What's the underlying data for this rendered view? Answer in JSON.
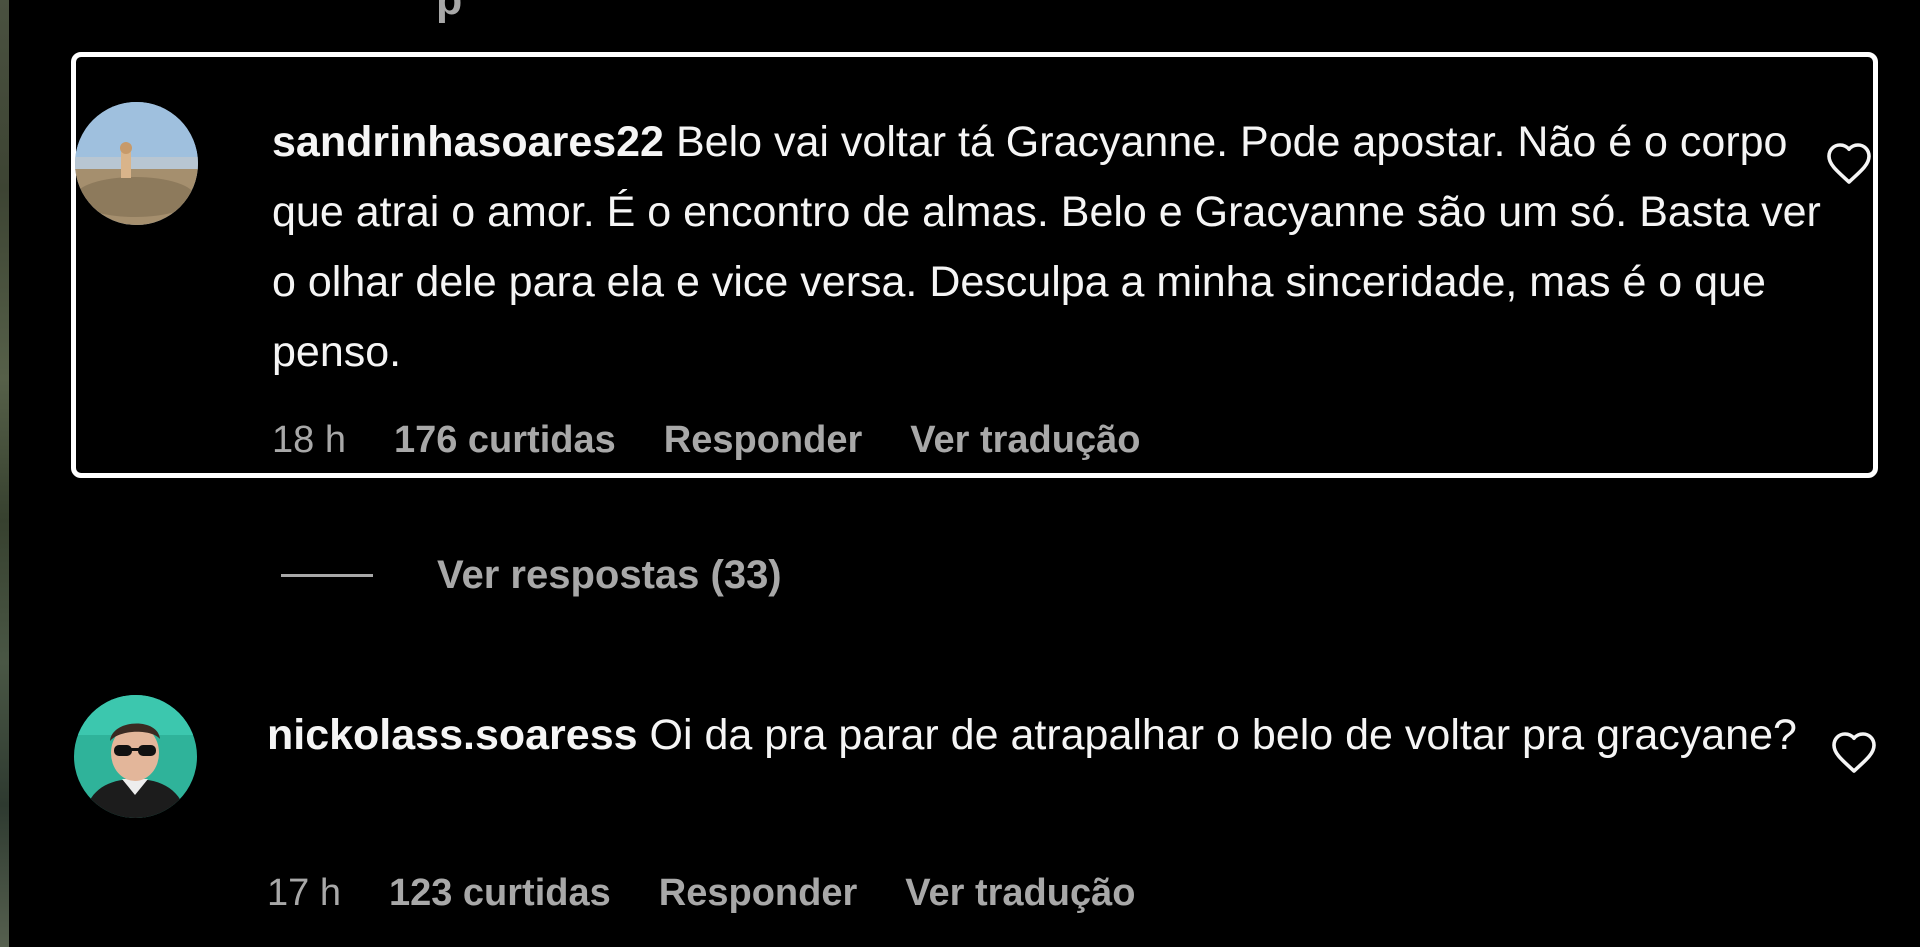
{
  "top_partial": "p",
  "comments": [
    {
      "username": "sandrinhasoares22",
      "text": "Belo vai voltar tá Gracyanne. Pode apostar. Não é o corpo que atrai o amor. É o encontro de almas. Belo e Gracyanne são um só. Basta ver o olhar dele para ela e vice versa. Desculpa a minha sinceridade, mas é o que penso.",
      "time": "18 h",
      "likes": "176 curtidas",
      "reply_label": "Responder",
      "translate_label": "Ver tradução",
      "like_icon": "heart-outline-icon"
    },
    {
      "username": "nickolass.soaress",
      "text": "Oi da pra parar de atrapalhar o belo de voltar pra gracyane?",
      "time": "17 h",
      "likes": "123 curtidas",
      "reply_label": "Responder",
      "translate_label": "Ver tradução",
      "like_icon": "heart-outline-icon"
    }
  ],
  "view_replies": {
    "label": "Ver respostas (33)"
  },
  "colors": {
    "background": "#000000",
    "primary_text": "#f5f5f5",
    "secondary_text": "#a8a8a8",
    "highlight_border": "#ffffff"
  }
}
